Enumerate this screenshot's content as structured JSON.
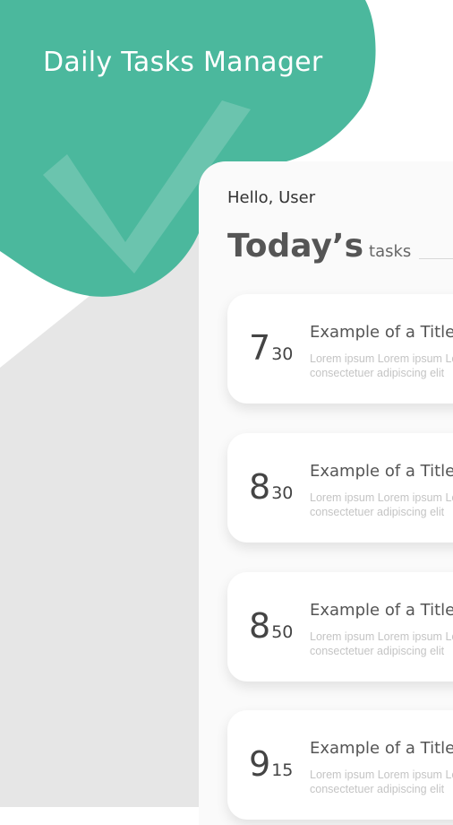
{
  "app": {
    "title": "Daily Tasks Manager"
  },
  "colors": {
    "accent": "#4bb89d",
    "panel_bg": "#fafafa",
    "shadow_bg": "#e6e6e6"
  },
  "header": {
    "greeting": "Hello,  User",
    "heading_main": "Today’s",
    "heading_sub": "tasks"
  },
  "tasks": [
    {
      "hour": "7",
      "minute": "30",
      "title": "Example of a Title",
      "desc_line1": "Lorem ipsum Lorem ipsum Lorem ipsu",
      "desc_line2": "consectetuer adipiscing elit"
    },
    {
      "hour": "8",
      "minute": "30",
      "title": "Example of a Title",
      "desc_line1": "Lorem ipsum Lorem ipsum Lorem ipsu",
      "desc_line2": "consectetuer adipiscing elit"
    },
    {
      "hour": "8",
      "minute": "50",
      "title": "Example of a Title",
      "desc_line1": "Lorem ipsum Lorem ipsum Lorem ipsu",
      "desc_line2": "consectetuer adipiscing elit"
    },
    {
      "hour": "9",
      "minute": "15",
      "title": "Example of a Title",
      "desc_line1": "Lorem ipsum Lorem ipsum Lorem ipsu",
      "desc_line2": "consectetuer adipiscing elit"
    }
  ]
}
